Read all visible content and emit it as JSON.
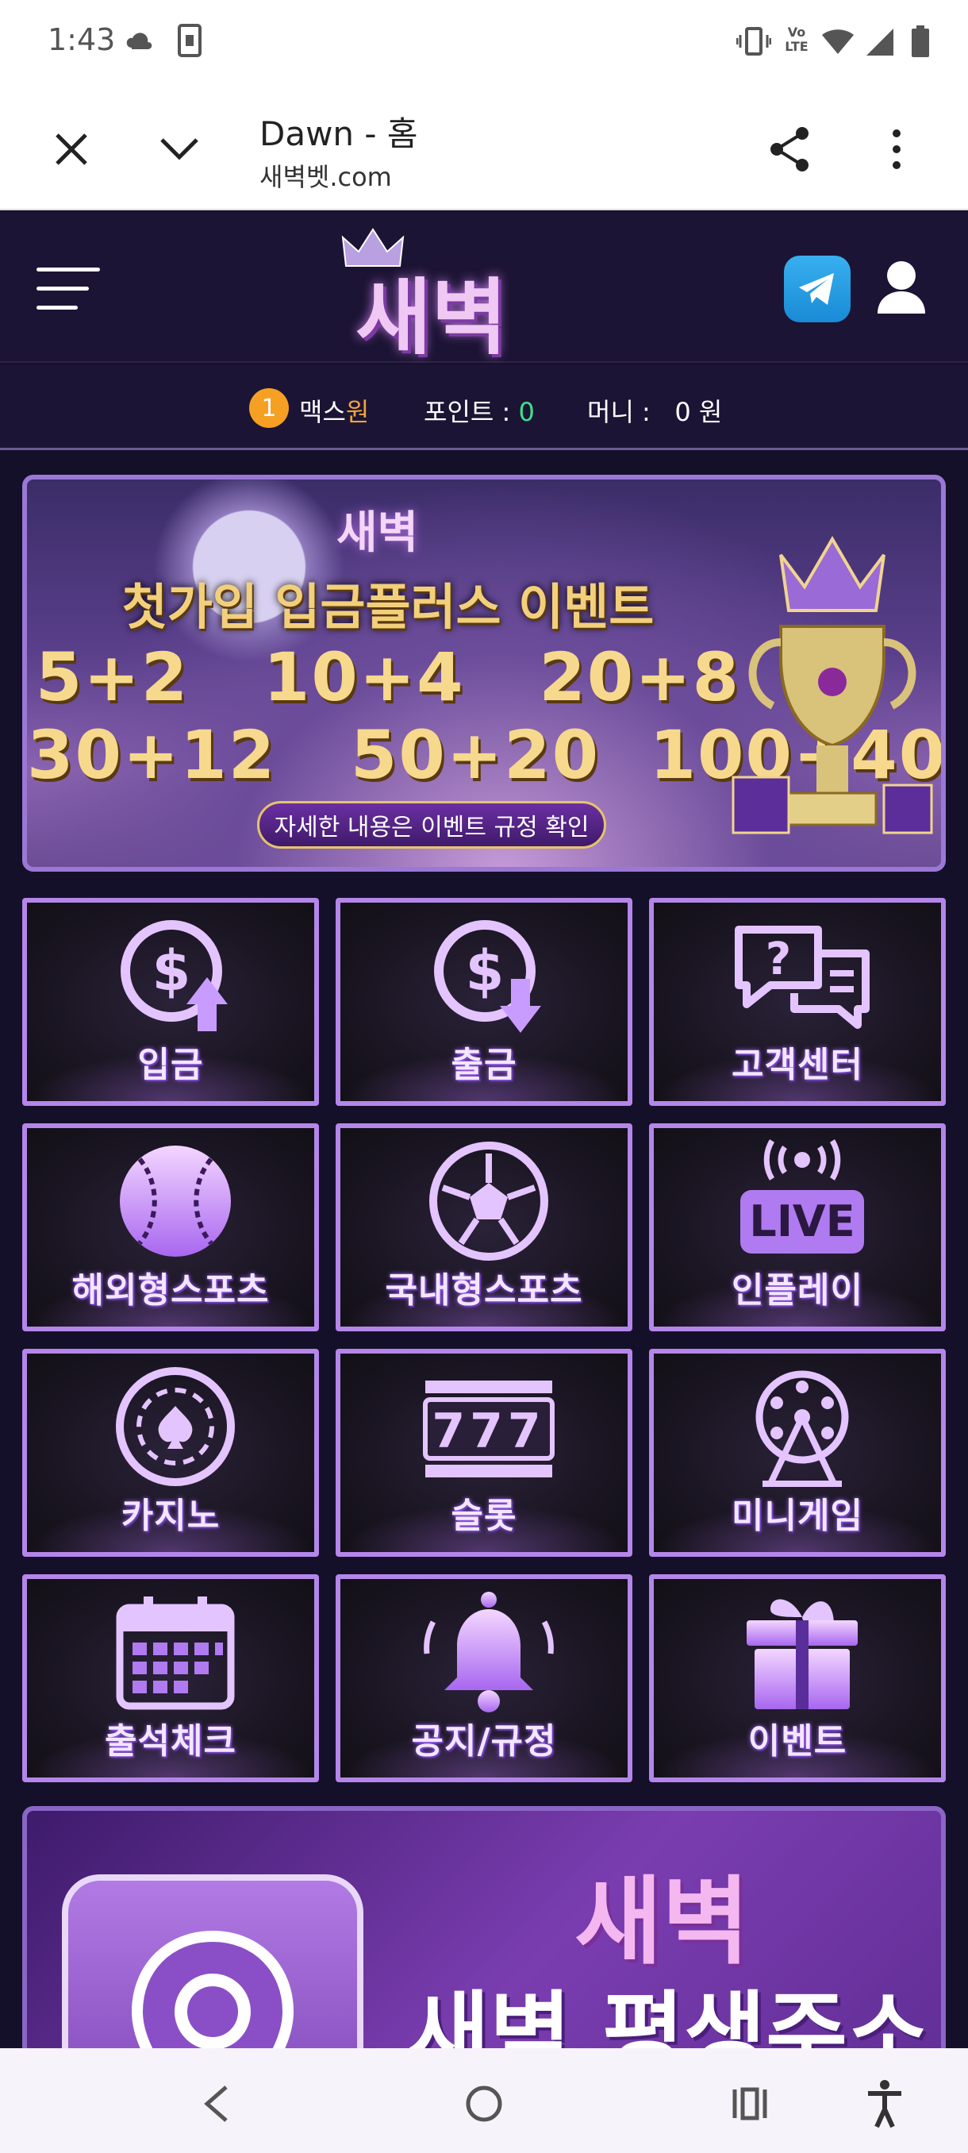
{
  "status_bar": {
    "time": "1:43",
    "icons": [
      "cloud-icon",
      "sim-card-icon",
      "vibrate-icon",
      "volte-icon",
      "wifi-icon",
      "signal-icon",
      "battery-icon"
    ],
    "volte_label": "Vo LTE"
  },
  "browser": {
    "title": "Dawn - 홈",
    "url": "새벽벳.com"
  },
  "site": {
    "brand": "새벽",
    "level": "1",
    "username_prefix": "맥스",
    "username_highlight": "원",
    "points_label": "포인트 : ",
    "points_value": "0",
    "money_label": "머니 :   0 원"
  },
  "banner": {
    "brand": "새벽",
    "title": "첫가입 입금플러스 이벤트",
    "row1": "5+2   10+4   20+8",
    "row2": "30+12   50+20  100+40",
    "cta": "자세한 내용은 이벤트 규정 확인"
  },
  "tiles": [
    {
      "label": "입금",
      "icon": "deposit-dollar-icon"
    },
    {
      "label": "출금",
      "icon": "withdraw-dollar-icon"
    },
    {
      "label": "고객센터",
      "icon": "chat-help-icon"
    },
    {
      "label": "해외형스포츠",
      "icon": "baseball-icon"
    },
    {
      "label": "국내형스포츠",
      "icon": "soccer-ball-icon"
    },
    {
      "label": "인플레이",
      "icon": "live-broadcast-icon",
      "badge": "LIVE"
    },
    {
      "label": "카지노",
      "icon": "casino-chip-icon"
    },
    {
      "label": "슬롯",
      "icon": "slot-machine-icon",
      "badge": "777"
    },
    {
      "label": "미니게임",
      "icon": "ferris-wheel-icon"
    },
    {
      "label": "출석체크",
      "icon": "calendar-icon"
    },
    {
      "label": "공지/규정",
      "icon": "bell-icon"
    },
    {
      "label": "이벤트",
      "icon": "gift-icon"
    }
  ],
  "promo": {
    "brand": "새벽",
    "title": "새벽 평생주소"
  },
  "colors": {
    "accent": "#b486ea",
    "points": "#3ee08a",
    "highlight": "#f2a53a",
    "background": "#15102a"
  }
}
